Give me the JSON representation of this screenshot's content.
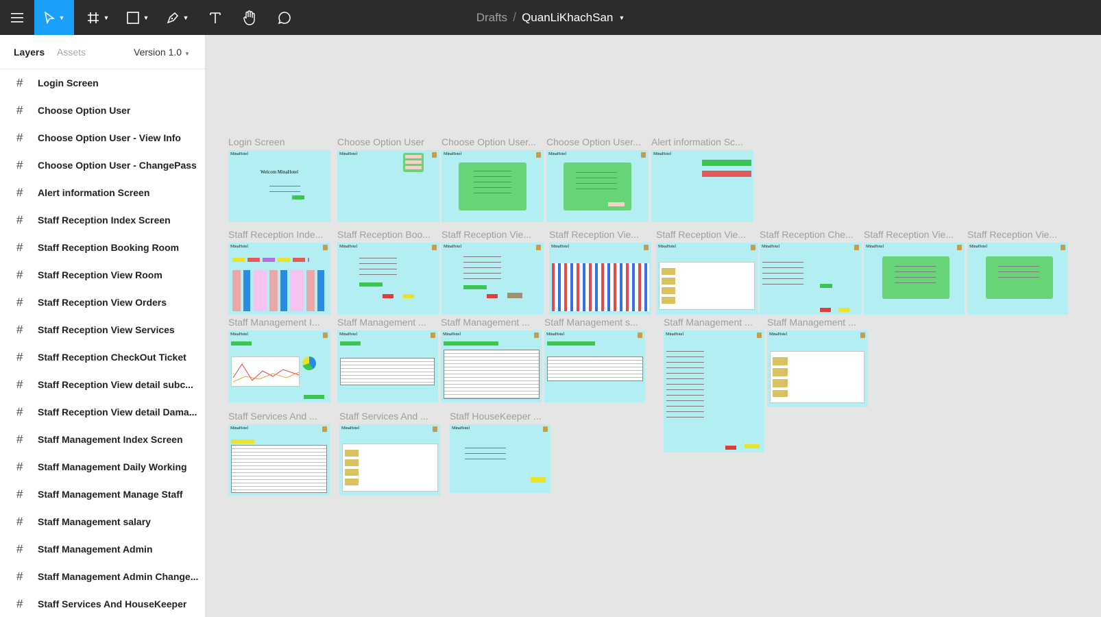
{
  "toolbar": {
    "breadcrumb": "Drafts",
    "separator": "/",
    "document_name": "QuanLiKhachSan",
    "tools": [
      "menu-icon",
      "move-icon",
      "frame-icon",
      "shape-icon",
      "pen-icon",
      "text-icon",
      "hand-icon",
      "comment-icon"
    ]
  },
  "panel": {
    "tab_layers": "Layers",
    "tab_assets": "Assets",
    "version": "Version 1.0",
    "layers": [
      "Login Screen",
      "Choose Option User",
      "Choose Option User - View Info",
      "Choose Option User - ChangePass",
      "Alert information Screen",
      "Staff Reception Index Screen",
      "Staff Reception Booking Room",
      "Staff Reception View Room",
      "Staff Reception View Orders",
      "Staff Reception View Services",
      "Staff Reception CheckOut Ticket",
      "Staff Reception View detail  subc...",
      "Staff Reception View detail  Dama...",
      "Staff Management Index Screen",
      "Staff Management Daily Working",
      "Staff Management Manage Staff",
      "Staff Management salary",
      "Staff Management Admin",
      "Staff Management Admin Change...",
      "Staff Services And HouseKeeper"
    ]
  },
  "canvas": {
    "brand": "MinaHotel",
    "frames": [
      {
        "label": "Login Screen",
        "heading": "Welcom MinaHotel"
      },
      {
        "label": "Choose Option User"
      },
      {
        "label": "Choose Option User..."
      },
      {
        "label": "Choose Option User..."
      },
      {
        "label": "Alert information Sc..."
      },
      {
        "label": "Staff Reception Inde..."
      },
      {
        "label": "Staff Reception Boo..."
      },
      {
        "label": "Staff Reception Vie..."
      },
      {
        "label": "Staff Reception Vie..."
      },
      {
        "label": "Staff Reception Vie..."
      },
      {
        "label": "Staff Reception Che..."
      },
      {
        "label": "Staff Reception Vie..."
      },
      {
        "label": "Staff Reception Vie..."
      },
      {
        "label": "Staff Management I..."
      },
      {
        "label": "Staff Management ..."
      },
      {
        "label": "Staff Management ..."
      },
      {
        "label": "Staff Management s..."
      },
      {
        "label": "Staff Management ..."
      },
      {
        "label": "Staff Management ..."
      },
      {
        "label": "Staff Services And ..."
      },
      {
        "label": "Staff Services And ..."
      },
      {
        "label": "Staff HouseKeeper ..."
      }
    ]
  }
}
